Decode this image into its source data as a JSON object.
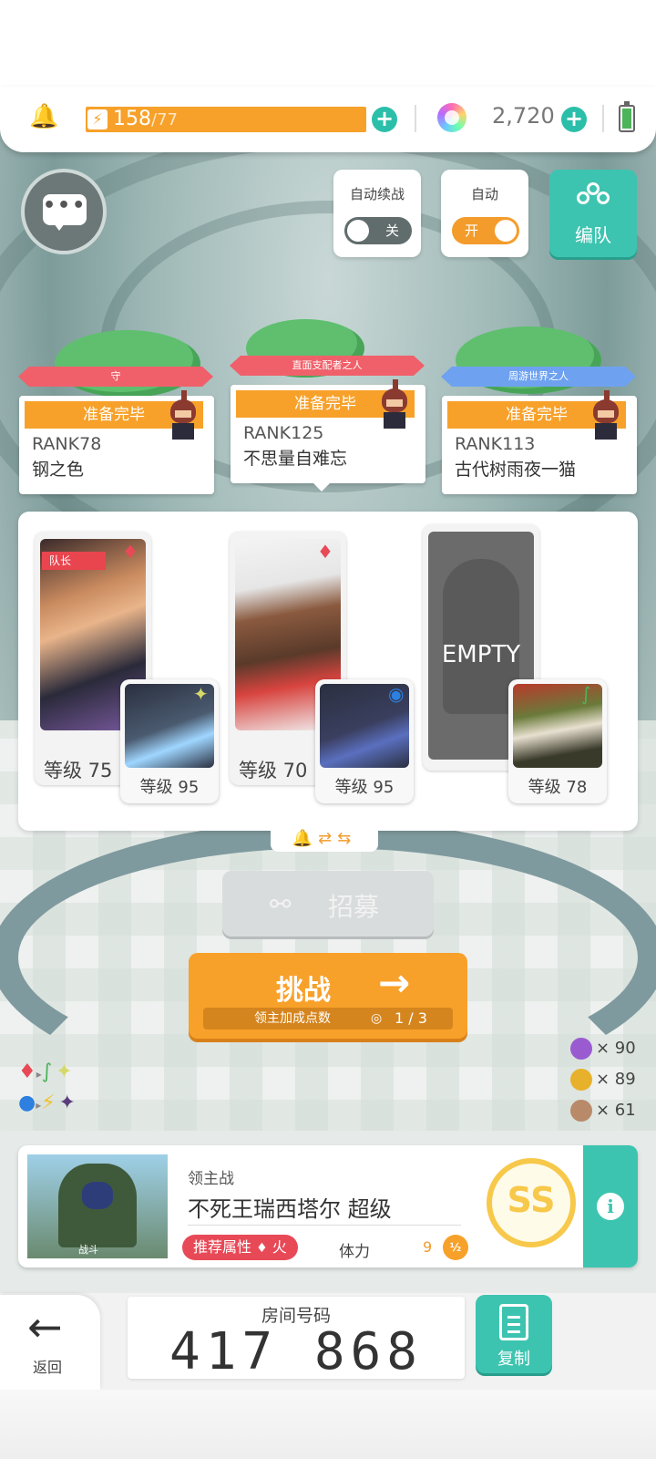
{
  "status_bar": {
    "energy_current": "158",
    "energy_max": "/77",
    "gems": "2,720"
  },
  "toggles": {
    "auto_continue": {
      "label": "自动续战",
      "state": "关"
    },
    "auto": {
      "label": "自动",
      "state": "开"
    },
    "team_button": "编队"
  },
  "players": [
    {
      "title": "守",
      "status": "准备完毕",
      "rank": "RANK78",
      "name": "钢之色"
    },
    {
      "title": "直面支配者之人",
      "status": "准备完毕",
      "rank": "RANK125",
      "name": "不思量自难忘"
    },
    {
      "title": "周游世界之人",
      "status": "准备完毕",
      "rank": "RANK113",
      "name": "古代树雨夜一猫"
    }
  ],
  "heroes": [
    {
      "level": "等级 75",
      "leader_tag": "队长",
      "pet_level": "等级 95"
    },
    {
      "level": "等级 70",
      "pet_level": "等级 95"
    },
    {
      "empty_text": "EMPTY",
      "pet_level": "等级 78"
    }
  ],
  "recruit_label": "招募",
  "challenge": {
    "label": "挑战",
    "sub_label": "领主加成点数",
    "sub_value": "1 / 3"
  },
  "resources": [
    {
      "count": "× 90",
      "color": "#9a5bd1"
    },
    {
      "count": "× 89",
      "color": "#e8b12b"
    },
    {
      "count": "× 61",
      "color": "#b98a6a"
    }
  ],
  "boss": {
    "art_tag": "战斗",
    "kicker": "领主战",
    "name": "不死王瑞西塔尔 超级",
    "recommend_label": "推荐属性",
    "recommend_element": "火",
    "stamina_label": "体力",
    "stamina_value": "9",
    "stamina_badge": "½",
    "grade": "SS"
  },
  "room": {
    "label": "房间号码",
    "number": "417 868"
  },
  "back_label": "返回",
  "copy_label": "复制",
  "colors": {
    "accent_orange": "#f7a12a",
    "accent_teal": "#3dc4b0",
    "fire_red": "#e84957"
  }
}
